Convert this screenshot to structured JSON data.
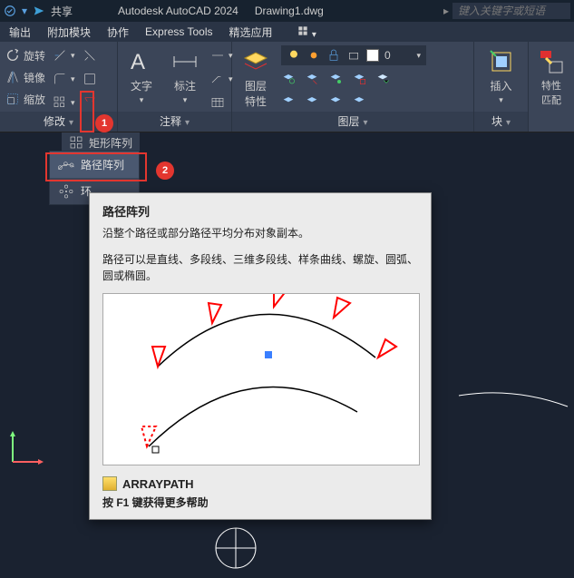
{
  "titlebar": {
    "share": "共享",
    "app": "Autodesk AutoCAD 2024",
    "doc": "Drawing1.dwg",
    "search_placeholder": "键入关键字或短语"
  },
  "menubar": [
    "输出",
    "附加模块",
    "协作",
    "Express Tools",
    "精选应用"
  ],
  "ribbon": {
    "modify": {
      "name": "修改",
      "rotate": "旋转",
      "mirror": "镜像",
      "scale": "缩放",
      "rect_array": "矩形阵列"
    },
    "annotate": {
      "name": "注释",
      "text": "文字",
      "dim": "标注"
    },
    "layers": {
      "name": "图层",
      "props": "图层\n特性"
    },
    "block": {
      "name": "块",
      "insert": "插入"
    },
    "props": {
      "name": "特性\n匹配"
    }
  },
  "dropdown": {
    "path_array": "路径阵列",
    "polar_array": "环"
  },
  "tooltip": {
    "title": "路径阵列",
    "desc1": "沿整个路径或部分路径平均分布对象副本。",
    "desc2": "路径可以是直线、多段线、三维多段线、样条曲线、螺旋、圆弧、圆或椭圆。",
    "cmd": "ARRAYPATH",
    "f1": "按 F1 键获得更多帮助"
  },
  "annotations": {
    "badge1": "1",
    "badge2": "2"
  }
}
